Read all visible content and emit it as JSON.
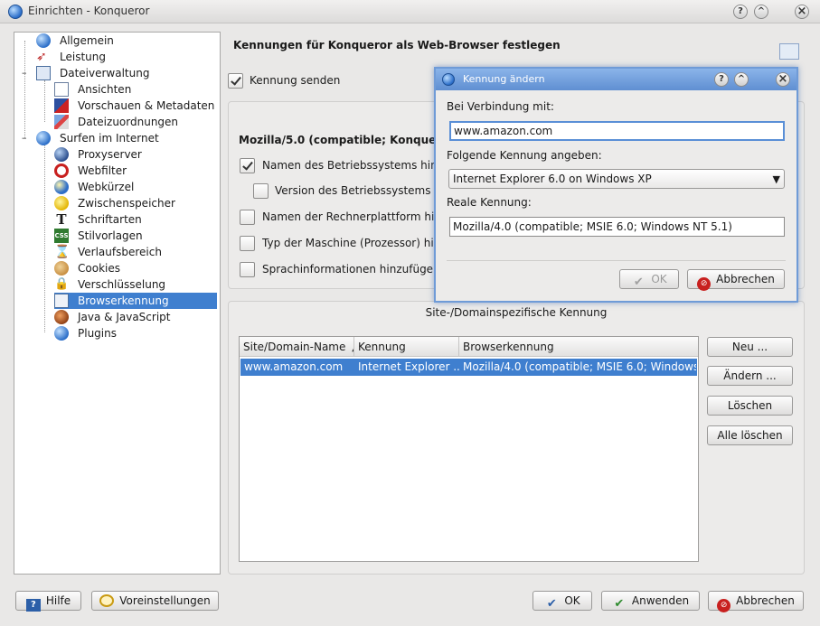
{
  "window": {
    "title": "Einrichten - Konqueror",
    "help_btn": "?",
    "minimize_btn": "^",
    "close_btn": "×"
  },
  "sidebar": {
    "items": [
      {
        "label": "Allgemein",
        "icon": "globe-icon"
      },
      {
        "label": "Leistung",
        "icon": "rocket-icon"
      },
      {
        "label": "Dateiverwaltung",
        "icon": "file-manager-icon"
      },
      {
        "label": "Ansichten",
        "icon": "view-icon"
      },
      {
        "label": "Vorschauen & Metadaten",
        "icon": "preview-icon"
      },
      {
        "label": "Dateizuordnungen",
        "icon": "file-association-icon"
      },
      {
        "label": "Surfen im Internet",
        "icon": "globe-icon"
      },
      {
        "label": "Proxyserver",
        "icon": "proxy-icon"
      },
      {
        "label": "Webfilter",
        "icon": "filter-icon"
      },
      {
        "label": "Webkürzel",
        "icon": "web-shortcut-icon"
      },
      {
        "label": "Zwischenspeicher",
        "icon": "cache-icon"
      },
      {
        "label": "Schriftarten",
        "icon": "font-icon"
      },
      {
        "label": "Stilvorlagen",
        "icon": "stylesheet-icon"
      },
      {
        "label": "Verlaufsbereich",
        "icon": "history-icon"
      },
      {
        "label": "Cookies",
        "icon": "cookie-icon"
      },
      {
        "label": "Verschlüsselung",
        "icon": "lock-icon"
      },
      {
        "label": "Browserkennung",
        "icon": "browser-id-icon"
      },
      {
        "label": "Java & JavaScript",
        "icon": "java-icon"
      },
      {
        "label": "Plugins",
        "icon": "plugin-icon"
      }
    ],
    "collapse_marker": "–"
  },
  "main": {
    "heading": "Kennungen für Konqueror als Web-Browser festlegen",
    "send_id_label": "Kennung senden",
    "ua_string": "Mozilla/5.0 (compatible; Konqueror/4.1",
    "options": [
      {
        "label": "Namen des Betriebssystems hinzu",
        "checked": true
      },
      {
        "label": "Version des Betriebssystems hin",
        "checked": false
      },
      {
        "label": "Namen der Rechnerplattform hinzu",
        "checked": false
      },
      {
        "label": "Typ der Maschine (Prozessor) hinz",
        "checked": false
      },
      {
        "label": "Sprachinformationen hinzufügen",
        "checked": false
      }
    ],
    "site_group_title": "Site-/Domainspezifische Kennung",
    "table": {
      "columns": [
        "Site/Domain-Name",
        "Kennung",
        "Browserkennung"
      ],
      "sort_arrow": "▲",
      "rows": [
        [
          "www.amazon.com",
          "Internet Explorer ...",
          "Mozilla/4.0 (compatible; MSIE 6.0; Windows ..."
        ]
      ]
    },
    "buttons": {
      "new": "Neu ...",
      "change": "Ändern ...",
      "delete": "Löschen",
      "delete_all": "Alle löschen"
    }
  },
  "bottom": {
    "help": "Hilfe",
    "defaults": "Voreinstellungen",
    "ok": "OK",
    "apply": "Anwenden",
    "cancel": "Abbrechen"
  },
  "dialog": {
    "title": "Kennung ändern",
    "connection_label": "Bei Verbindung mit:",
    "connection_value": "www.amazon.com",
    "id_label": "Folgende Kennung angeben:",
    "id_selected": "Internet Explorer 6.0 on Windows XP",
    "real_id_label": "Reale Kennung:",
    "real_id_value": "Mozilla/4.0 (compatible; MSIE 6.0; Windows NT 5.1)",
    "ok": "OK",
    "cancel": "Abbrechen",
    "help_btn": "?",
    "minimize_btn": "^",
    "close_btn": "×"
  },
  "colors": {
    "selection": "#3f7fcf",
    "dialog_title": "#6f9bd7"
  }
}
